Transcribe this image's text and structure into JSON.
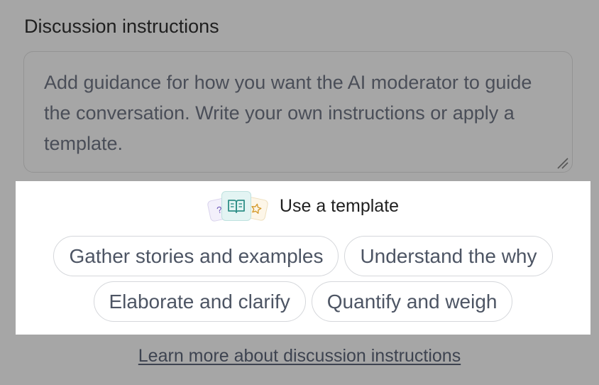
{
  "section": {
    "label": "Discussion instructions"
  },
  "instructions_field": {
    "placeholder": "Add guidance for how you want the AI moderator to guide the conversation. Write your own instructions or apply a template.",
    "value": ""
  },
  "template_panel": {
    "title": "Use a template",
    "icons": [
      "question-card-icon",
      "open-book-icon",
      "star-card-icon"
    ],
    "options": [
      {
        "label": "Gather stories and examples"
      },
      {
        "label": "Understand the why"
      },
      {
        "label": "Elaborate and clarify"
      },
      {
        "label": "Quantify and weigh"
      }
    ],
    "icon_colors": {
      "question": "#6b57b8",
      "book": "#2f8f88",
      "star": "#d39a2c"
    }
  },
  "learn_more": {
    "label": "Learn more about discussion instructions"
  },
  "colors": {
    "overlay": "#a6a6a6",
    "panel": "#ffffff",
    "chip_text": "#4d5564"
  }
}
